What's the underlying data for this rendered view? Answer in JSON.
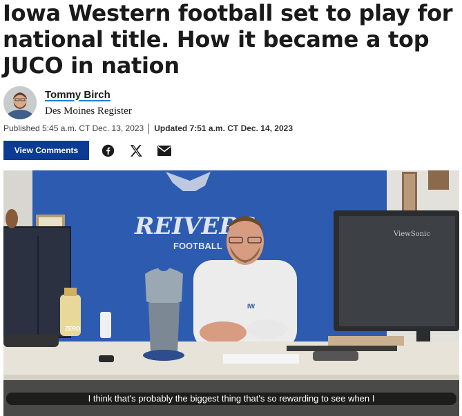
{
  "article": {
    "headline": "Iowa Western football set to play for national title. How it became a top JUCO in nation"
  },
  "byline": {
    "author": "Tommy Birch",
    "publication": "Des Moines Register"
  },
  "dates": {
    "published": "Published 5:45 a.m. CT Dec. 13, 2023",
    "updated": "Updated 7:51 a.m. CT Dec. 14, 2023"
  },
  "actions": {
    "comments_label": "View Comments",
    "share_icons": [
      "facebook-icon",
      "x-icon",
      "email-icon"
    ]
  },
  "video": {
    "wall_sign_main": "REIVERS",
    "wall_sign_sub": "FOOTBALL",
    "monitor_brand": "ViewSonic",
    "bottle_label": "ZERO",
    "shirt_logo": "IW",
    "caption": "I think that's probably the biggest thing that's so rewarding to see when I"
  },
  "colors": {
    "accent_button": "#0b3b95",
    "author_underline": "#1a7fd6",
    "facebook": "#1a1a1a",
    "wall_blue": "#2d5bb0"
  }
}
